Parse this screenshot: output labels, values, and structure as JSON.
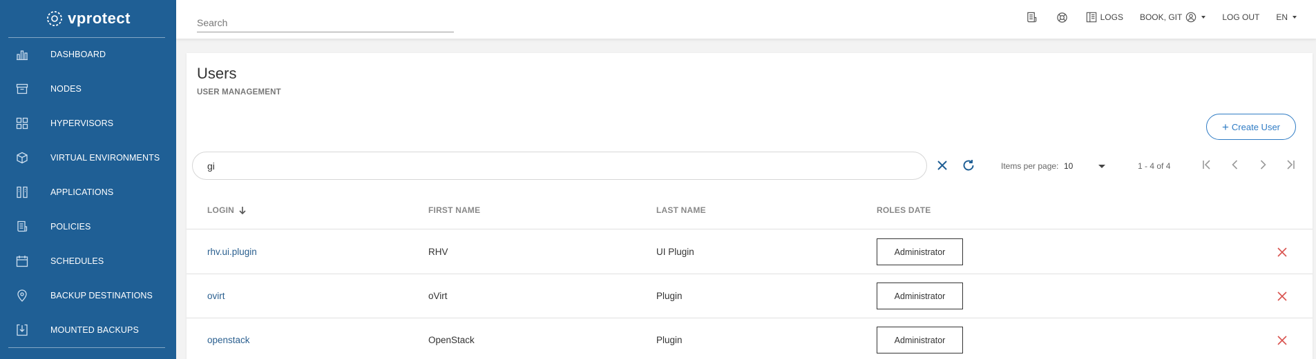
{
  "app": {
    "logo_text": "vprotect"
  },
  "sidebar": {
    "items": [
      {
        "label": "DASHBOARD",
        "icon": "bar-chart-icon"
      },
      {
        "label": "NODES",
        "icon": "archive-box-icon"
      },
      {
        "label": "HYPERVISORS",
        "icon": "grid-icon"
      },
      {
        "label": "VIRTUAL ENVIRONMENTS",
        "icon": "cube-icon"
      },
      {
        "label": "APPLICATIONS",
        "icon": "app-columns-icon"
      },
      {
        "label": "POLICIES",
        "icon": "receipt-icon"
      },
      {
        "label": "SCHEDULES",
        "icon": "calendar-icon"
      },
      {
        "label": "BACKUP DESTINATIONS",
        "icon": "location-pin-icon"
      },
      {
        "label": "MOUNTED BACKUPS",
        "icon": "download-box-icon"
      }
    ]
  },
  "topbar": {
    "search_placeholder": "Search",
    "logs_label": "LOGS",
    "user_label": "BOOK, GIT",
    "logout_label": "LOG OUT",
    "language_label": "EN"
  },
  "page": {
    "title": "Users",
    "subtitle": "USER MANAGEMENT",
    "create_button": "Create User",
    "filter_value": "gi",
    "items_per_page_label": "Items per page:",
    "items_per_page_value": "10",
    "range_label": "1 - 4 of 4"
  },
  "table": {
    "columns": {
      "login": "LOGIN",
      "first_name": "FIRST NAME",
      "last_name": "LAST NAME",
      "roles_date": "ROLES DATE"
    },
    "rows": [
      {
        "login": "rhv.ui.plugin",
        "first_name": "RHV",
        "last_name": "UI Plugin",
        "role": "Administrator"
      },
      {
        "login": "ovirt",
        "first_name": "oVirt",
        "last_name": "Plugin",
        "role": "Administrator"
      },
      {
        "login": "openstack",
        "first_name": "OpenStack",
        "last_name": "Plugin",
        "role": "Administrator"
      }
    ]
  },
  "colors": {
    "sidebar_bg": "#1f5f95",
    "accent": "#2e7bc4",
    "delete": "#d9534f"
  }
}
